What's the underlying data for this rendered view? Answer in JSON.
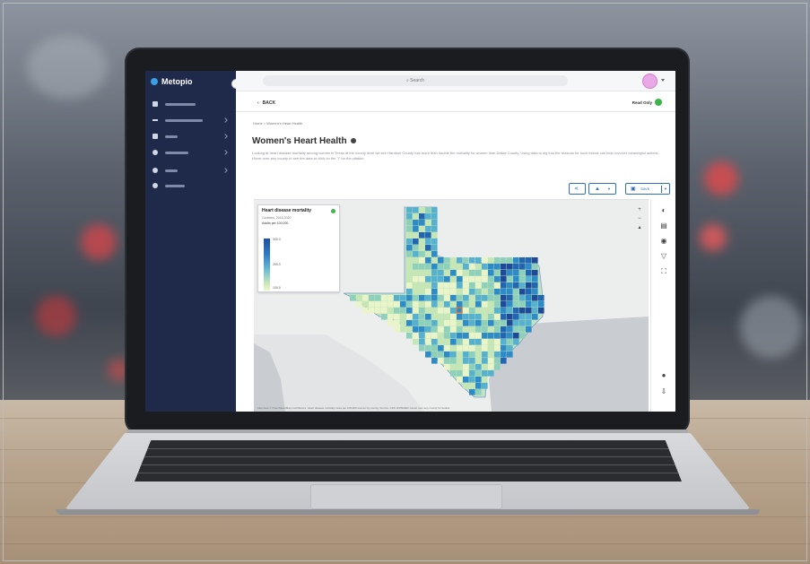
{
  "app": {
    "brand": "Metopio",
    "search_placeholder": "Search",
    "sidebar_items": [
      {
        "icon": "folder-icon",
        "label": "Workspaces",
        "has_children": false
      },
      {
        "icon": "plus-icon",
        "label": "Create Visualization",
        "has_children": true
      },
      {
        "icon": "table-icon",
        "label": "Data",
        "has_children": true
      },
      {
        "icon": "location-icon",
        "label": "My Places",
        "has_children": true
      },
      {
        "icon": "help-icon",
        "label": "Help",
        "has_children": true
      },
      {
        "icon": "gear-icon",
        "label": "Settings",
        "has_children": false
      }
    ]
  },
  "page": {
    "back_label": "BACK",
    "read_state": "Read Only",
    "breadcrumb": "Home  >  Women's Heart Health",
    "title": "Women's Heart Health",
    "description": "Looking at heart disease mortality among women in Texas at the county level we see Harrison County has more than double the mortality for women than Dallas County. Using data to dig into the reasons for such trends can help uncover meaningful actions. Hover over any county to see the data or click on the \"i\" for the citation."
  },
  "toolbar": {
    "share_icon": "share-icon",
    "layers_icon": "layers-icon",
    "save_label": "SAVE"
  },
  "map": {
    "legend": {
      "title": "Heart disease mortality",
      "subtitle": "Counties, 2016-2020",
      "metric": "Adults per 100,000",
      "ticks": [
        "300.0",
        "200.0",
        "100.0"
      ]
    },
    "attribution": "Map data © OpenStreetMap contributors. Heart disease mortality rates per 100,000 women by county. Source: CDC WONDER. Hover over any county for details."
  },
  "colors": {
    "sidebar": "#1f2a4a",
    "accent": "#2e6fb8",
    "status_green": "#3cb54a"
  }
}
